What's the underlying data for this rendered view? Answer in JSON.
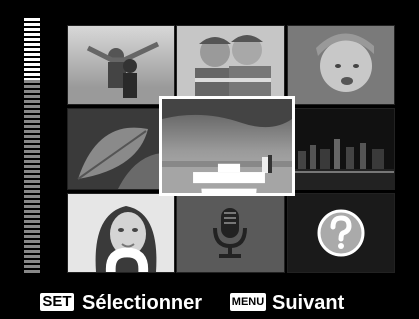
{
  "footer": {
    "set_key": "SET",
    "select_label": "Sélectionner",
    "menu_key": "MENU",
    "next_label": "Suivant"
  },
  "icons": {
    "trash": "trash-icon",
    "lock": "lock-icon",
    "microphone": "microphone-icon",
    "help": "question-mark-icon"
  },
  "colors": {
    "background": "#000000",
    "selection_border": "#ffffff",
    "text": "#ffffff"
  }
}
